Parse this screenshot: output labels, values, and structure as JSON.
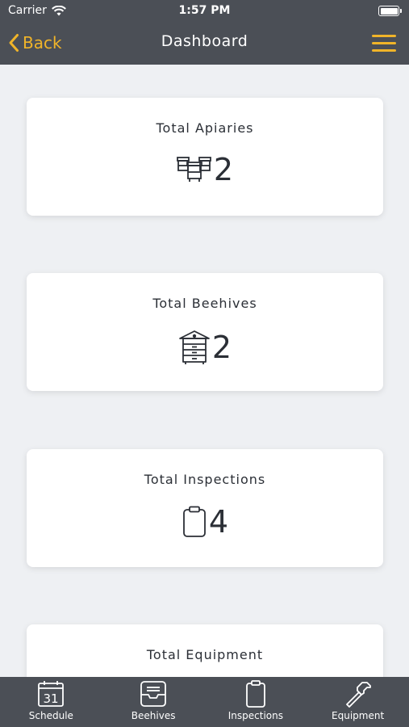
{
  "status_bar": {
    "carrier": "Carrier",
    "time": "1:57 PM"
  },
  "nav": {
    "back_label": "Back",
    "title": "Dashboard"
  },
  "cards": [
    {
      "title": "Total Apiaries",
      "value": "2",
      "icon": "apiary-icon"
    },
    {
      "title": "Total Beehives",
      "value": "2",
      "icon": "beehive-icon"
    },
    {
      "title": "Total Inspections",
      "value": "4",
      "icon": "clipboard-icon"
    },
    {
      "title": "Total Equipment",
      "value": "",
      "icon": ""
    }
  ],
  "tabs": [
    {
      "label": "Schedule",
      "icon": "calendar-icon",
      "day": "31"
    },
    {
      "label": "Beehives",
      "icon": "inbox-icon"
    },
    {
      "label": "Inspections",
      "icon": "clipboard-icon"
    },
    {
      "label": "Equipment",
      "icon": "hammer-icon"
    }
  ],
  "colors": {
    "accent": "#f0b429",
    "bar": "#4b4f56",
    "background": "#eef0f3",
    "text": "#2b2f36"
  }
}
